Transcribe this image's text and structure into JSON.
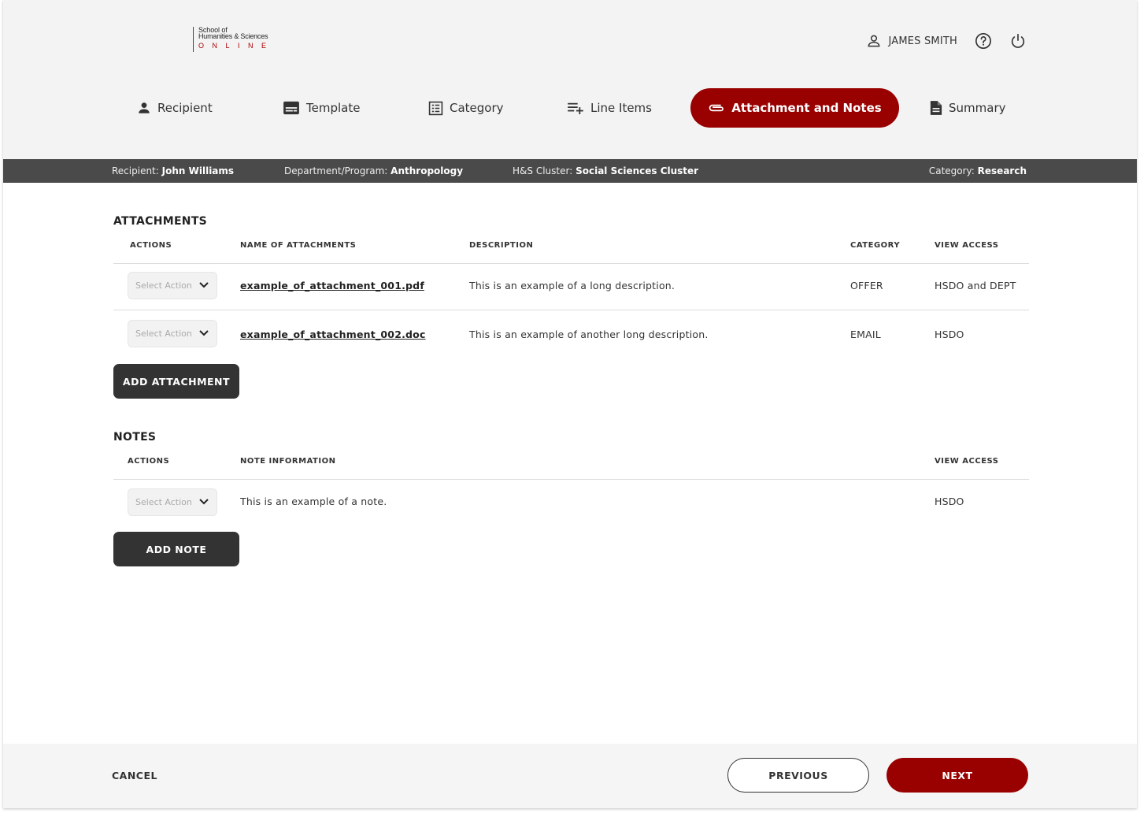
{
  "logo": {
    "line1": "School of",
    "line2": "Humanities & Sciences",
    "line3": "ONLINE"
  },
  "user": {
    "name": "JAMES SMITH"
  },
  "tabs": [
    {
      "label": "Recipient"
    },
    {
      "label": "Template"
    },
    {
      "label": "Category"
    },
    {
      "label": "Line Items"
    },
    {
      "label": "Attachment and Notes",
      "active": true
    },
    {
      "label": "Summary"
    }
  ],
  "infobar": {
    "recipient_label": "Recipient:",
    "recipient_value": "John Williams",
    "department_label": "Department/Program:",
    "department_value": "Anthropology",
    "cluster_label": "H&S Cluster:",
    "cluster_value": "Social Sciences Cluster",
    "category_label": "Category:",
    "category_value": "Research"
  },
  "attachments": {
    "title": "ATTACHMENTS",
    "headers": {
      "actions": "ACTIONS",
      "name": "NAME OF ATTACHMENTS",
      "description": "DESCRIPTION",
      "category": "CATEGORY",
      "view_access": "VIEW ACCESS"
    },
    "rows": [
      {
        "action_placeholder": "Select Action",
        "name": "example_of_attachment_001.pdf",
        "description": "This is an example of a long description.",
        "category": "OFFER",
        "view_access": "HSDO and DEPT"
      },
      {
        "action_placeholder": "Select Action",
        "name": "example_of_attachment_002.doc",
        "description": "This is an example of another long description.",
        "category": "EMAIL",
        "view_access": "HSDO"
      }
    ],
    "add_label": "ADD ATTACHMENT"
  },
  "notes": {
    "title": "NOTES",
    "headers": {
      "actions": "ACTIONS",
      "info": "NOTE INFORMATION",
      "view_access": "VIEW ACCESS"
    },
    "rows": [
      {
        "action_placeholder": "Select Action",
        "info": "This is an example of a note.",
        "view_access": "HSDO"
      }
    ],
    "add_label": "ADD NOTE"
  },
  "footer": {
    "cancel_label": "CANCEL",
    "previous_label": "PREVIOUS",
    "next_label": "NEXT"
  },
  "colors": {
    "accent": "#990000",
    "dark": "#333333",
    "infobar": "#4a4a4a"
  }
}
